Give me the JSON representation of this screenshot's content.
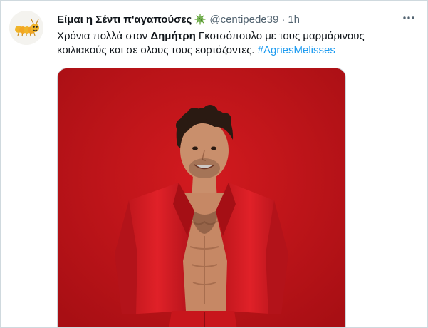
{
  "tweet": {
    "display_name": "Είμαι η Σέντι π'αγαπούσες",
    "name_emoji": "microbe-emoji",
    "handle": "@centipede39",
    "separator": "·",
    "time": "1h",
    "text_line1_prefix": "Χρόνια πολλά στον ",
    "text_bold_name": "Δημήτρη",
    "text_line1_suffix": " Γκοτσόπουλο με τους μαρμάρινους",
    "text_line2": "κοιλιακούς και σε ολους τους εορτάζοντες. ",
    "hashtag": "#AgriesMelisses",
    "more_icon": "more-horizontal-icon",
    "avatar_icon": "centipede-avatar",
    "media_description_icon": "photo"
  },
  "colors": {
    "text_primary": "#0f1419",
    "text_secondary": "#536471",
    "link": "#1d9bf0",
    "photo_background": "#c0151a",
    "suit": "#d3171d",
    "border": "#cfd9de"
  }
}
